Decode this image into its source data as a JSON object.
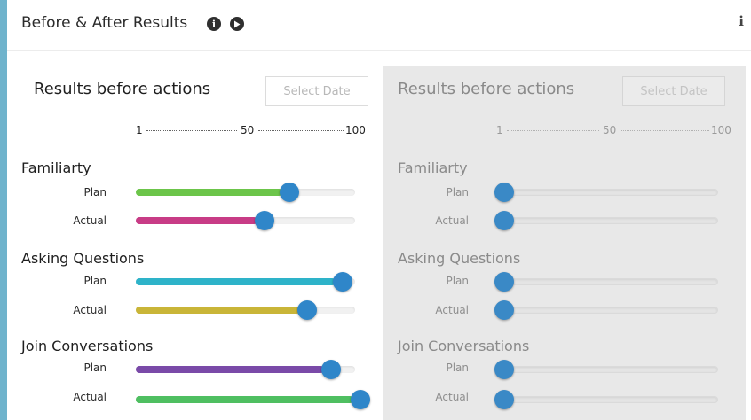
{
  "header": {
    "title": "Before & After Results"
  },
  "icons": {
    "info": "info-icon",
    "play": "play-icon",
    "corner_info": "info-icon"
  },
  "colors": {
    "thumb": "#2f86c9",
    "familiarity_plan": "#6cc54a",
    "familiarity_actual": "#c83c86",
    "asking_plan": "#2eb3c9",
    "asking_actual": "#c9b538",
    "join_plan": "#7a4aa8",
    "join_actual": "#4fbf61"
  },
  "scale": {
    "min": "1",
    "mid": "50",
    "max": "100"
  },
  "panels": [
    {
      "title": "Results before actions",
      "date_button": "Select Date",
      "groups": [
        {
          "name": "Familiarty",
          "rows": [
            {
              "label": "Plan",
              "value": 67
            },
            {
              "label": "Actual",
              "value": 56
            }
          ]
        },
        {
          "name": "Asking Questions",
          "rows": [
            {
              "label": "Plan",
              "value": 91
            },
            {
              "label": "Actual",
              "value": 75
            }
          ]
        },
        {
          "name": "Join Conversations",
          "rows": [
            {
              "label": "Plan",
              "value": 86
            },
            {
              "label": "Actual",
              "value": 99
            }
          ]
        }
      ]
    },
    {
      "title": "Results before actions",
      "date_button": "Select Date",
      "groups": [
        {
          "name": "Familiarty",
          "rows": [
            {
              "label": "Plan",
              "value": 1
            },
            {
              "label": "Actual",
              "value": 1
            }
          ]
        },
        {
          "name": "Asking Questions",
          "rows": [
            {
              "label": "Plan",
              "value": 1
            },
            {
              "label": "Actual",
              "value": 1
            }
          ]
        },
        {
          "name": "Join Conversations",
          "rows": [
            {
              "label": "Plan",
              "value": 1
            },
            {
              "label": "Actual",
              "value": 1
            }
          ]
        }
      ]
    }
  ]
}
